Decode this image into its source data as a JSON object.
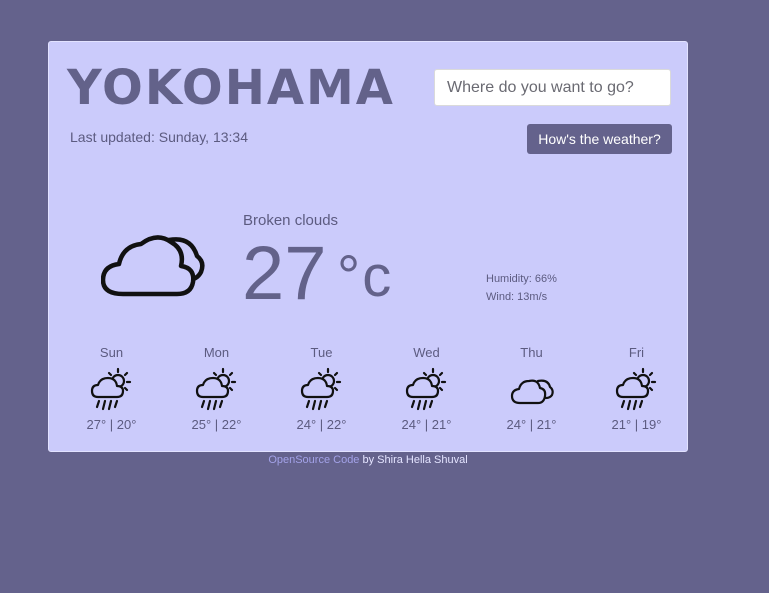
{
  "header": {
    "city": "YOKOHAMA",
    "search_placeholder": "Where do you want to go?",
    "search_button": "How's the weather?",
    "last_updated": "Last updated: Sunday, 13:34"
  },
  "current": {
    "description": "Broken clouds",
    "temperature": "27",
    "unit": "°c",
    "icon": "cloud-icon",
    "humidity": "Humidity: 66%",
    "wind": "Wind: 13m/s"
  },
  "forecast": [
    {
      "day": "Sun",
      "temps": "27° | 20°",
      "icon": "sun-rain-icon"
    },
    {
      "day": "Mon",
      "temps": "25° | 22°",
      "icon": "sun-rain-icon"
    },
    {
      "day": "Tue",
      "temps": "24° | 22°",
      "icon": "sun-rain-icon"
    },
    {
      "day": "Wed",
      "temps": "24° | 21°",
      "icon": "sun-rain-icon"
    },
    {
      "day": "Thu",
      "temps": "24° | 21°",
      "icon": "cloud-icon"
    },
    {
      "day": "Fri",
      "temps": "21° | 19°",
      "icon": "sun-rain-icon"
    }
  ],
  "footer": {
    "link": "OpenSource Code",
    "credit": "by Shira Hella Shuval"
  },
  "colors": {
    "background": "#64628c",
    "card": "#cbcbfb",
    "accent": "#63628a"
  }
}
